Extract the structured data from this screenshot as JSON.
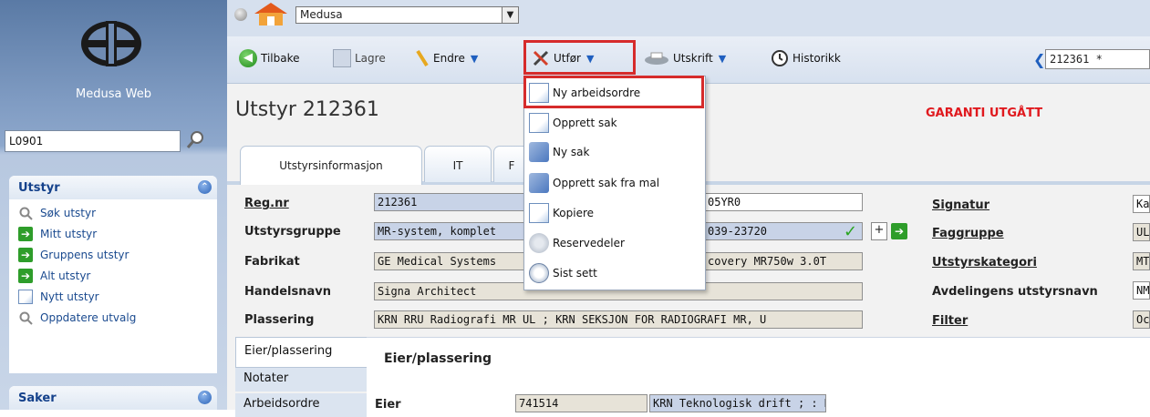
{
  "app": {
    "name": "Medusa Web",
    "search_value": "L0901"
  },
  "sidebar": {
    "utstyr": {
      "title": "Utstyr",
      "items": [
        {
          "label": "Søk utstyr",
          "icon": "magnifier-icon"
        },
        {
          "label": "Mitt utstyr",
          "icon": "green-arrow-icon"
        },
        {
          "label": "Gruppens utstyr",
          "icon": "green-arrow-icon"
        },
        {
          "label": "Alt utstyr",
          "icon": "green-arrow-icon"
        },
        {
          "label": "Nytt utstyr",
          "icon": "document-icon"
        },
        {
          "label": "Oppdatere utvalg",
          "icon": "magnifier-icon"
        }
      ]
    },
    "saker": {
      "title": "Saker"
    }
  },
  "topbar": {
    "select_value": "Medusa"
  },
  "toolbar": {
    "back": "Tilbake",
    "save": "Lagre",
    "edit": "Endre",
    "execute": "Utfør",
    "print": "Utskrift",
    "history": "Historikk",
    "record_nav_value": "212361 *"
  },
  "dropdown": [
    "Ny arbeidsordre",
    "Opprett sak",
    "Ny sak",
    "Opprett sak fra mal",
    "Kopiere",
    "Reservedeler",
    "Sist sett"
  ],
  "page": {
    "title": "Utstyr 212361",
    "warranty": "GARANTI UTGÅTT"
  },
  "tabs": [
    "Utstyrsinformasjon",
    "IT",
    "F"
  ],
  "fields": {
    "regnr": {
      "label": "Reg.nr",
      "value": "212361",
      "value2": "05YR0"
    },
    "gruppe": {
      "label": "Utstyrsgruppe",
      "value": "MR-system, komplet",
      "value2": "039-23720"
    },
    "fabrikat": {
      "label": "Fabrikat",
      "value": "GE Medical Systems",
      "value2": "covery MR750w 3.0T"
    },
    "handelsnavn": {
      "label": "Handelsnavn",
      "value": "Signa Architect"
    },
    "plassering": {
      "label": "Plassering",
      "value": "KRN RRU Radiografi MR UL ; KRN SEKSJON FOR RADIOGRAFI MR, U"
    },
    "signatur": {
      "label": "Signatur",
      "value": "Ka"
    },
    "faggruppe": {
      "label": "Faggruppe",
      "value": "UL"
    },
    "kategori": {
      "label": "Utstyrskategori",
      "value": "MT"
    },
    "avd_navn": {
      "label": "Avdelingens utstyrsnavn",
      "value": "NM"
    },
    "filter": {
      "label": "Filter",
      "value": "Oc"
    }
  },
  "side_tabs": [
    "Eier/plassering",
    "Notater",
    "Arbeidsordre"
  ],
  "section": {
    "title": "Eier/plassering",
    "eier_label": "Eier",
    "eier_value": "741514",
    "eier_desc": "KRN Teknologisk drift ; : KRN AVDELING FOR TEKNOLOGISK DR"
  },
  "colors": {
    "accent": "#14418b",
    "warning": "#e0191e",
    "highlight": "#d62b2b"
  }
}
